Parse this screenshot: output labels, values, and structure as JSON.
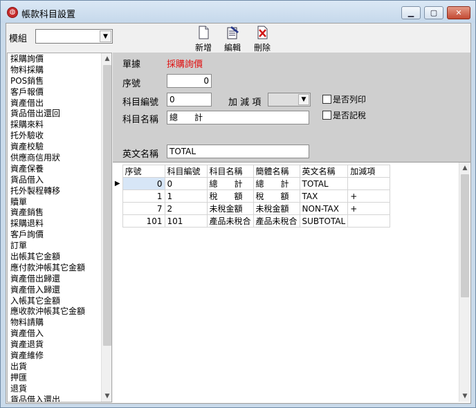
{
  "window": {
    "title": "帳款科目設置",
    "minimize": "▭",
    "maximize": "□",
    "close": "✕"
  },
  "toolbar": {
    "module_label": "模組",
    "module_value": "",
    "buttons": [
      {
        "label": "新增",
        "icon": "new-document-icon"
      },
      {
        "label": "編輯",
        "icon": "edit-document-icon"
      },
      {
        "label": "刪除",
        "icon": "delete-document-icon"
      }
    ]
  },
  "sidebar": {
    "items": [
      "採購詢價",
      "物料採購",
      "POS銷售",
      "客戶報價",
      "資產借出",
      "貨品借出還回",
      "採購來料",
      "托外驗收",
      "資產校驗",
      "供應商信用狀",
      "資產保養",
      "貨品借入",
      "托外製程轉移",
      "贖單",
      "資產銷售",
      "採購退料",
      "客戶詢價",
      "訂單",
      "出帳其它金額",
      "應付款沖帳其它金額",
      "資產借出歸還",
      "資產借入歸還",
      "入帳其它金額",
      "應收款沖帳其它金額",
      "物料請購",
      "資產借入",
      "資產退貨",
      "資產維修",
      "出貨",
      "押匯",
      "退貨",
      "貨品借入還出"
    ]
  },
  "form": {
    "doc_label": "單據",
    "doc_value": "採購詢價",
    "seq_label": "序號",
    "seq_value": "0",
    "code_label": "科目編號",
    "code_value": "0",
    "addsub_label": "加 減 項",
    "addsub_value": "",
    "print_label": "是否列印",
    "tax_label": "是否記稅",
    "name_label": "科目名稱",
    "name_value": "總　　計",
    "en_label": "英文名稱",
    "en_value": "TOTAL"
  },
  "grid": {
    "headers": [
      "序號",
      "科目編號",
      "科目名稱",
      "簡體名稱",
      "英文名稱",
      "加減項"
    ],
    "rows": [
      {
        "seq": "0",
        "code": "0",
        "name": "總　　計",
        "simp": "總　　計",
        "en": "TOTAL",
        "sign": ""
      },
      {
        "seq": "1",
        "code": "1",
        "name": "稅　　額",
        "simp": "稅　　額",
        "en": "TAX",
        "sign": "+"
      },
      {
        "seq": "7",
        "code": "2",
        "name": "未稅金額",
        "simp": "未稅金額",
        "en": "NON-TAX",
        "sign": "+"
      },
      {
        "seq": "101",
        "code": "101",
        "name": "產品未稅合",
        "simp": "產品未稅合",
        "en": "SUBTOTAL",
        "sign": ""
      }
    ],
    "current_row_marker": "▶"
  },
  "colors": {
    "accent_red": "#e01010",
    "titlebar": "#c9daea"
  }
}
